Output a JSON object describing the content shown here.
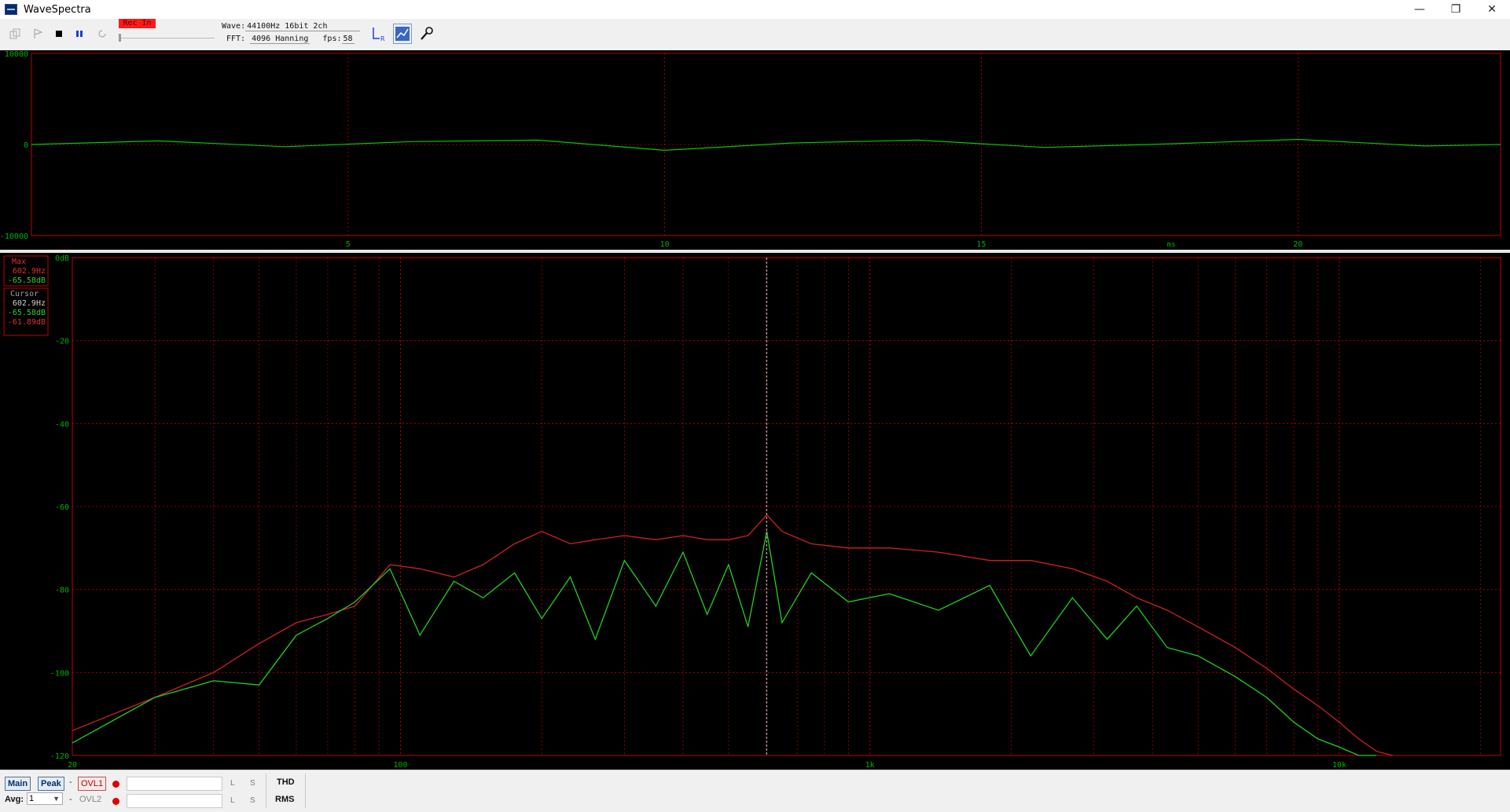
{
  "window": {
    "title": "WaveSpectra",
    "minimize": "—",
    "restore": "❐",
    "close": "✕"
  },
  "toolbar": {
    "rec_badge": "Rec In",
    "wave_label": "Wave:",
    "wave_value": "44100Hz 16bit 2ch",
    "fft_label": "FFT:",
    "fft_value": "4096 Hanning",
    "fps_label": "fps:",
    "fps_value": "58",
    "icons": [
      "copy-icon",
      "play-icon",
      "stop-icon",
      "pause-icon",
      "loop-icon",
      "channel-lr-icon",
      "hz-scale-icon",
      "settings-wrench-icon"
    ]
  },
  "wave_plot": {
    "y_ticks": [
      "10000",
      "0",
      "-10000"
    ],
    "x_ticks": [
      "5",
      "10",
      "15",
      "20"
    ],
    "x_unit": "ms",
    "y_range": [
      -10000,
      10000
    ],
    "x_range_ms": [
      0,
      23.2
    ],
    "colors": {
      "trace": "#00c800",
      "border": "#c00000",
      "grid": "#c00000",
      "text": "#00b400"
    }
  },
  "spectrum_plot": {
    "y_ticks": [
      "0dB",
      "-20",
      "-40",
      "-60",
      "-80",
      "-100",
      "-120"
    ],
    "x_ticks": [
      "20",
      "100",
      "1k",
      "10k"
    ],
    "max_box": {
      "label": "Max",
      "freq": "602.9Hz",
      "db": "-65.58dB"
    },
    "cursor_box": {
      "label": "Cursor",
      "freq": "602.9Hz",
      "db1": "-65.58dB",
      "db2": "-61.89dB"
    },
    "cursor_freq_hz": 602.9,
    "colors": {
      "peak_hold": "#d02020",
      "current": "#20d020",
      "grid": "#c00000",
      "text": "#00b400",
      "cursor": "#a0a0a0"
    }
  },
  "chart_data": {
    "type": "line",
    "x_scale": "log",
    "xlim": [
      20,
      22050
    ],
    "ylim": [
      -120,
      0
    ],
    "xlabel": "",
    "ylabel": "",
    "x_ticks": [
      "20",
      "100",
      "1k",
      "10k"
    ],
    "y_ticks": [
      "0dB",
      "-20",
      "-40",
      "-60",
      "-80",
      "-100",
      "-120"
    ],
    "series": [
      {
        "color": "#d02020",
        "x": [
          20,
          30,
          40,
          50,
          60,
          70,
          80,
          95,
          110,
          130,
          150,
          175,
          200,
          230,
          260,
          300,
          350,
          400,
          450,
          500,
          550,
          603,
          650,
          750,
          900,
          1100,
          1400,
          1800,
          2200,
          2700,
          3200,
          3700,
          4300,
          5000,
          6000,
          7000,
          8000,
          9000,
          10000,
          11000,
          12000,
          13000
        ],
        "values": [
          -114,
          -106,
          -100,
          -93,
          -88,
          -86,
          -84,
          -74,
          -75,
          -77,
          -74,
          -69,
          -66,
          -69,
          -68,
          -67,
          -68,
          -67,
          -68,
          -68,
          -67,
          -62,
          -66,
          -69,
          -70,
          -70,
          -71,
          -73,
          -73,
          -75,
          -78,
          -82,
          -85,
          -89,
          -94,
          -99,
          -104,
          -108,
          -112,
          -116,
          -119,
          -121
        ]
      },
      {
        "color": "#20d020",
        "x": [
          20,
          30,
          40,
          50,
          60,
          70,
          80,
          95,
          110,
          130,
          150,
          175,
          200,
          230,
          260,
          300,
          350,
          400,
          450,
          500,
          550,
          603,
          650,
          750,
          900,
          1100,
          1400,
          1800,
          2200,
          2700,
          3200,
          3700,
          4300,
          5000,
          6000,
          7000,
          8000,
          9000,
          10000,
          11000,
          12000
        ],
        "values": [
          -117,
          -106,
          -102,
          -103,
          -91,
          -87,
          -83,
          -75,
          -91,
          -78,
          -82,
          -76,
          -87,
          -77,
          -92,
          -73,
          -84,
          -71,
          -86,
          -74,
          -89,
          -66,
          -88,
          -76,
          -83,
          -81,
          -85,
          -79,
          -96,
          -82,
          -92,
          -84,
          -94,
          -96,
          -101,
          -106,
          -112,
          -116,
          -118,
          -120,
          -121
        ]
      }
    ],
    "secondary": {
      "type": "line",
      "title": "",
      "xlabel": "",
      "ylabel": "",
      "x_unit": "ms",
      "xlim": [
        0,
        23.2
      ],
      "ylim": [
        -10000,
        10000
      ],
      "x_ticks": [
        "5",
        "10",
        "15",
        "20"
      ],
      "y_ticks": [
        "10000",
        "0",
        "-10000"
      ],
      "series": [
        {
          "color": "#00c800",
          "x": [
            0,
            2,
            4,
            6,
            8,
            10,
            12,
            14,
            16,
            18,
            20,
            22,
            23.2
          ],
          "values": [
            0,
            50,
            -30,
            40,
            60,
            -80,
            20,
            60,
            -40,
            10,
            70,
            -20,
            0
          ]
        }
      ]
    }
  },
  "bottombar": {
    "main_btn": "Main",
    "peak_btn": "Peak",
    "dash1": "-",
    "ovl1_btn": "OVL1",
    "avg_label": "Avg:",
    "avg_value": "1",
    "dash2": "-",
    "ovl2_label": "OVL2",
    "l1": "L",
    "s1": "S",
    "l2": "L",
    "s2": "S",
    "thd_btn": "THD",
    "rms_btn": "RMS"
  }
}
